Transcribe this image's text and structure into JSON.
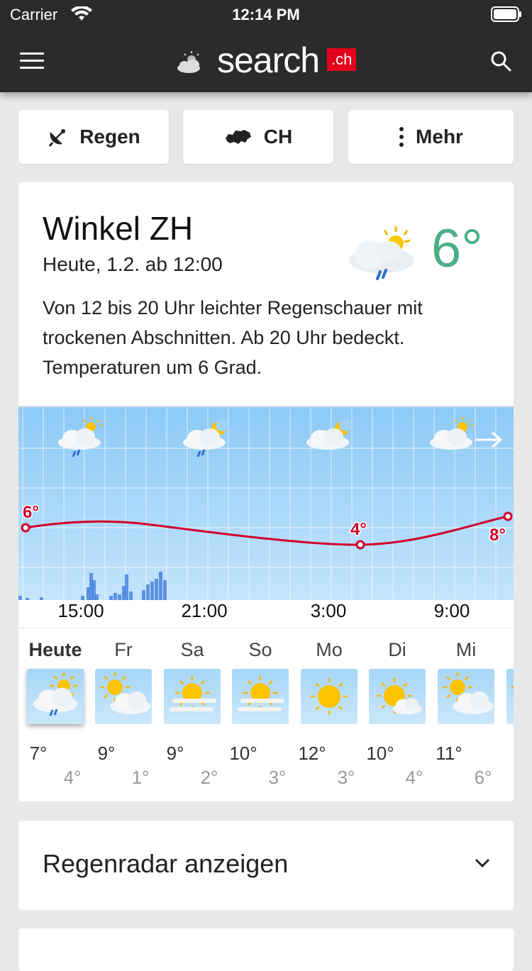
{
  "status": {
    "carrier": "Carrier",
    "time": "12:14 PM"
  },
  "nav": {
    "logo_word": "search",
    "logo_ch": ".ch"
  },
  "buttons": {
    "rain": "Regen",
    "country": "CH",
    "more": "Mehr"
  },
  "location": {
    "name": "Winkel ZH",
    "date": "Heute, 1.2. ab 12:00",
    "current_temp": "6°",
    "description": "Von 12 bis 20 Uhr leichter Regenschauer mit trockenen Abschnitten. Ab 20 Uhr bedeckt. Temperaturen um 6 Grad."
  },
  "hourly": {
    "labels": [
      "15:00",
      "21:00",
      "3:00",
      "9:00"
    ],
    "temp_labels": [
      "6°",
      "4°",
      "8°"
    ]
  },
  "days": [
    {
      "name": "Heute",
      "max": "7°",
      "min": "4°",
      "icon": "cloud-sun-rain-icon"
    },
    {
      "name": "Fr",
      "max": "9°",
      "min": "1°",
      "icon": "sun-cloud-icon"
    },
    {
      "name": "Sa",
      "max": "9°",
      "min": "2°",
      "icon": "sun-fog-icon"
    },
    {
      "name": "So",
      "max": "10°",
      "min": "3°",
      "icon": "sun-fog-icon"
    },
    {
      "name": "Mo",
      "max": "12°",
      "min": "3°",
      "icon": "sun-icon"
    },
    {
      "name": "Di",
      "max": "10°",
      "min": "4°",
      "icon": "sun-small-cloud-icon"
    },
    {
      "name": "Mi",
      "max": "11°",
      "min": "6°",
      "icon": "sun-cloud-icon"
    }
  ],
  "radar": {
    "label": "Regenradar anzeigen"
  },
  "colors": {
    "temp_green": "#4cae86",
    "temp_line": "#d0002a",
    "brand_red": "#e3001b"
  }
}
